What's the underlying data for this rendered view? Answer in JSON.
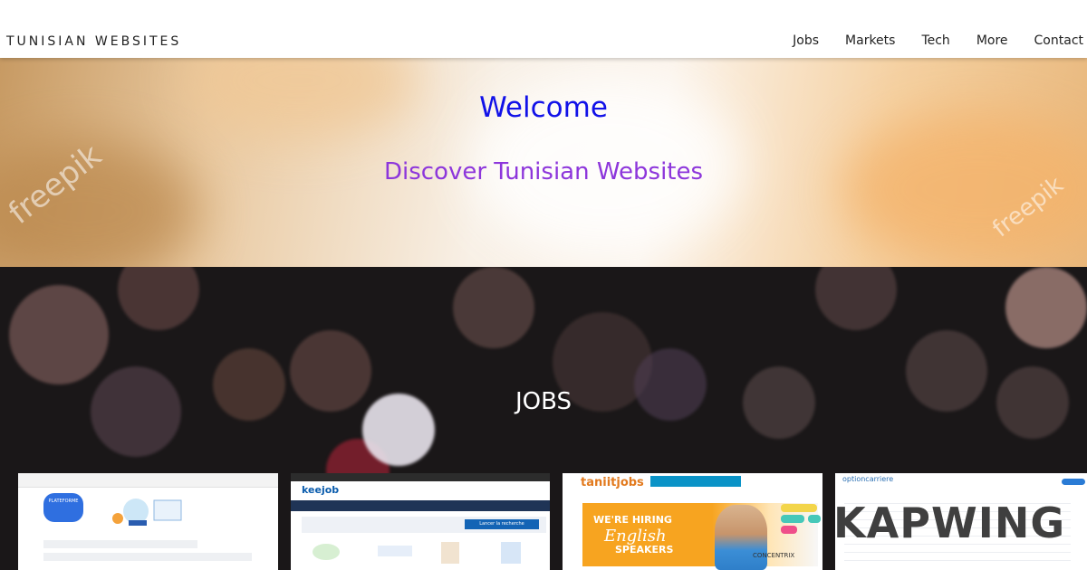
{
  "brand": "TUNISIAN WEBSITES",
  "nav": [
    "Jobs",
    "Markets",
    "Tech",
    "More",
    "Contact"
  ],
  "hero": {
    "title": "Welcome",
    "subtitle": "Discover Tunisian Websites",
    "watermark": "freepik"
  },
  "jobs": {
    "title": "JOBS",
    "cards": [
      {
        "badge": "PLATEFORME"
      },
      {
        "logo": "keejob",
        "search_button": "Lancer la recherche"
      },
      {
        "logo": "taniitjobs",
        "hire1": "WE'RE HIRING",
        "hire2": "English",
        "hire3": "SPEAKERS",
        "sponsor": "CONCENTRIX"
      },
      {
        "logo": "optioncarriere"
      }
    ]
  },
  "overlay": {
    "text": "KAPWING"
  },
  "colors": {
    "title": "#1111e8",
    "subtitle": "#8d36db",
    "jobs_bg": "#1a1718"
  }
}
